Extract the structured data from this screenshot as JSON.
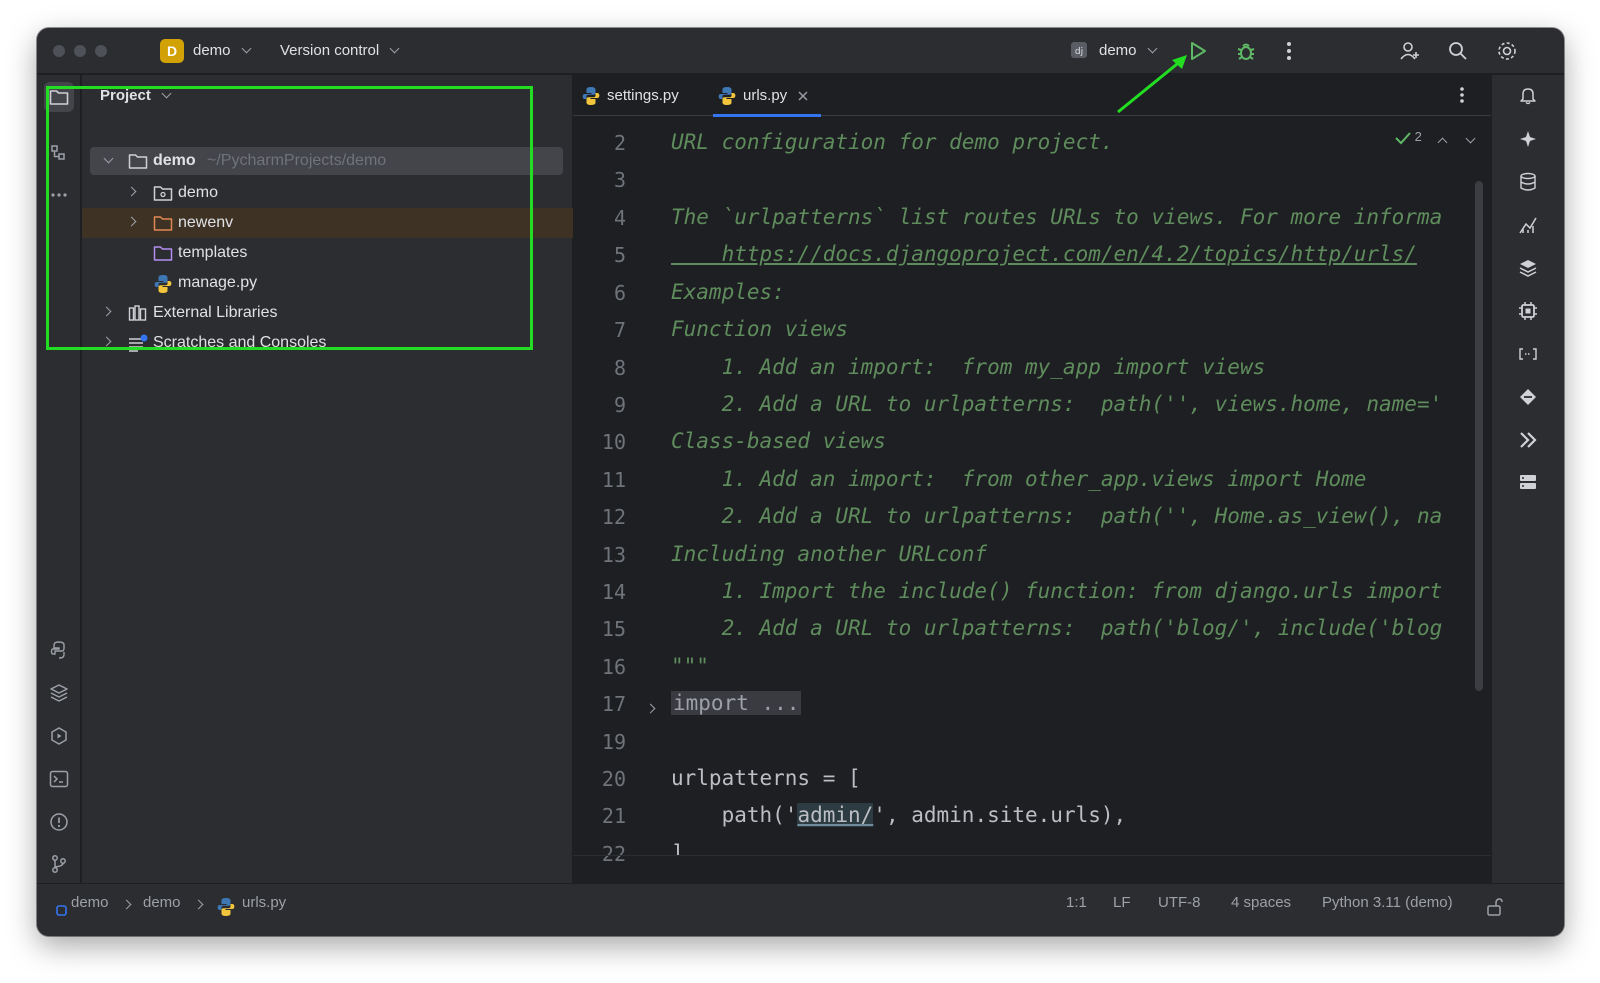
{
  "titlebar": {
    "project_initial": "D",
    "project_name": "demo",
    "vcs_label": "Version control",
    "run_config_label": "demo"
  },
  "project_panel": {
    "title": "Project",
    "tree": [
      {
        "label": "demo",
        "hint": "~/PycharmProjects/demo",
        "icon": "folder-icon"
      },
      {
        "label": "demo",
        "icon": "package-folder-icon"
      },
      {
        "label": "newenv",
        "icon": "excluded-folder-icon"
      },
      {
        "label": "templates",
        "icon": "templates-folder-icon"
      },
      {
        "label": "manage.py",
        "icon": "python-file-icon"
      },
      {
        "label": "External Libraries",
        "icon": "libraries-icon"
      },
      {
        "label": "Scratches and Consoles",
        "icon": "scratches-icon"
      }
    ]
  },
  "editor": {
    "tabs": [
      {
        "label": "settings.py",
        "active": false
      },
      {
        "label": "urls.py",
        "active": true
      }
    ],
    "inspection_count": "2",
    "line_numbers": [
      "2",
      "3",
      "4",
      "5",
      "6",
      "7",
      "8",
      "9",
      "10",
      "11",
      "12",
      "13",
      "14",
      "15",
      "16",
      "17",
      "19",
      "20",
      "21",
      "22"
    ],
    "lines": [
      "URL configuration for demo project.",
      "",
      "The `urlpatterns` list routes URLs to views. For more informa",
      "    https://docs.djangoproject.com/en/4.2/topics/http/urls/",
      "Examples:",
      "Function views",
      "    1. Add an import:  from my_app import views",
      "    2. Add a URL to urlpatterns:  path('', views.home, name='",
      "Class-based views",
      "    1. Add an import:  from other_app.views import Home",
      "    2. Add a URL to urlpatterns:  path('', Home.as_view(), na",
      "Including another URLconf",
      "    1. Import the include() function: from django.urls import",
      "    2. Add a URL to urlpatterns:  path('blog/', include('blog",
      "\"\"\"",
      "import ...",
      "",
      "urlpatterns = [",
      "    path('admin/', admin.site.urls),",
      "]"
    ],
    "line21": {
      "prefix": "    path('",
      "hl": "admin/",
      "suffix": "', admin.site.urls),"
    }
  },
  "statusbar": {
    "breadcrumb": [
      "demo",
      "demo",
      "urls.py"
    ],
    "position": "1:1",
    "line_sep": "LF",
    "encoding": "UTF-8",
    "indent": "4 spaces",
    "interpreter": "Python 3.11 (demo)"
  },
  "colors": {
    "accent": "#3574f0",
    "highlight_box": "#22dd22",
    "run_green": "#5fb865",
    "docstring": "#5f8c5c"
  }
}
